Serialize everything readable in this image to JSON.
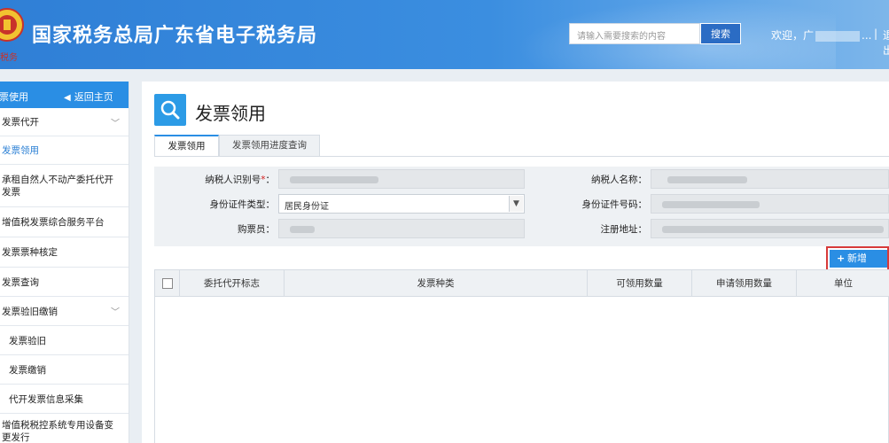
{
  "header": {
    "site_title": "国家税务总局广东省电子税务局",
    "emblem_text": "税务",
    "search_placeholder": "请输入需要搜索的内容",
    "search_button": "搜索",
    "welcome_prefix": "欢迎，广",
    "welcome_suffix": "...",
    "separator": "|",
    "logout": "退出"
  },
  "sidebar": {
    "header_title": "发票使用",
    "back_label": "返回主页",
    "items": [
      {
        "label": "发票代开",
        "expandable": true
      },
      {
        "label": "发票领用",
        "active": true
      },
      {
        "label": "承租自然人不动产委托代开发票"
      },
      {
        "label": "增值税发票综合服务平台"
      },
      {
        "label": "发票票种核定"
      },
      {
        "label": "发票查询"
      },
      {
        "label": "发票验旧缴销",
        "expandable": true
      },
      {
        "label": "发票验旧",
        "sub": true
      },
      {
        "label": "发票缴销",
        "sub": true
      },
      {
        "label": "代开发票信息采集",
        "sub": true
      },
      {
        "label": "增值税税控系统专用设备变更发行"
      }
    ]
  },
  "main": {
    "page_title": "发票领用",
    "tabs": [
      {
        "label": "发票领用",
        "active": true
      },
      {
        "label": "发票领用进度查询"
      }
    ],
    "form": {
      "taxpayer_id_label": "纳税人识别号",
      "taxpayer_id_required": "*",
      "taxpayer_name_label": "纳税人名称：",
      "id_type_label": "身份证件类型：",
      "id_type_value": "居民身份证",
      "id_number_label": "身份证件号码：",
      "buyer_label": "购票员：",
      "address_label": "注册地址："
    },
    "add_button": "新增",
    "table": {
      "columns": [
        "委托代开标志",
        "发票种类",
        "可领用数量",
        "申请领用数量",
        "单位"
      ],
      "rows": []
    }
  },
  "colors": {
    "header_blue": "#2f7fd6",
    "accent": "#2a8ee4",
    "highlight_red": "#d73a3a"
  }
}
